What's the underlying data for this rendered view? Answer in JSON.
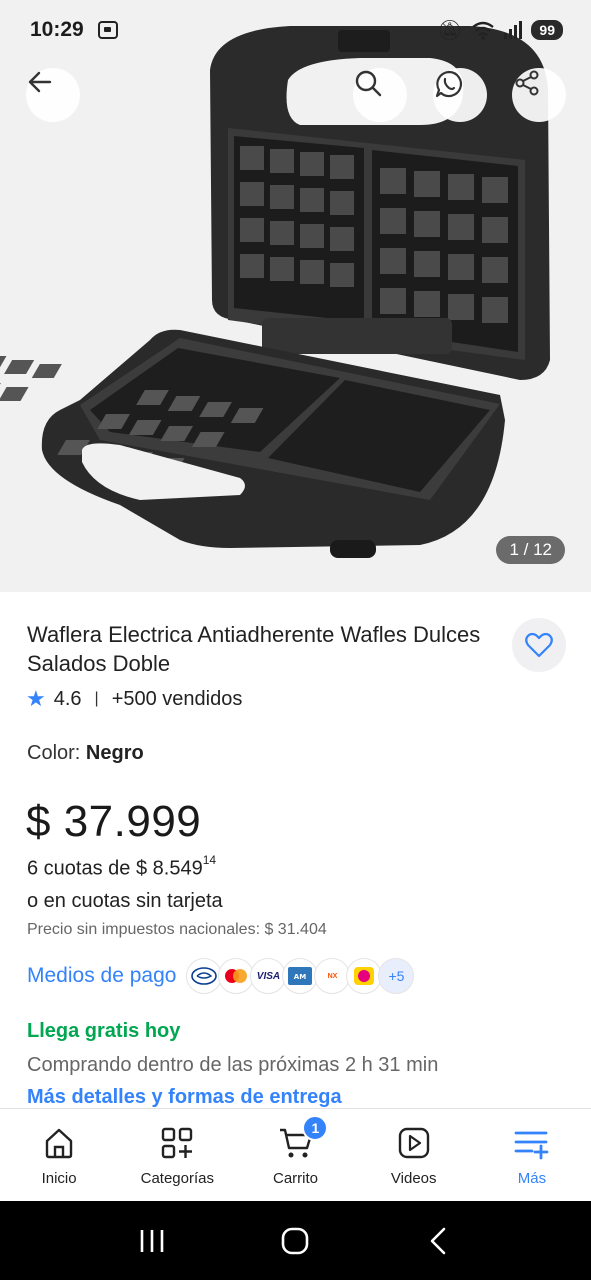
{
  "status_bar": {
    "time": "10:29",
    "battery": "99",
    "signal_label": "5"
  },
  "gallery": {
    "counter": "1 / 12"
  },
  "product": {
    "title": "Waflera Electrica Antiadherente Wafles Dulces Salados Doble",
    "rating": "4.6",
    "sold": "+500 vendidos",
    "color_label": "Color: ",
    "color_value": "Negro",
    "price": "$ 37.999",
    "installments_prefix": "6 cuotas de $ 8.549",
    "installments_cents": "14",
    "no_card": "o en cuotas sin tarjeta",
    "tax_note": "Precio sin impuestos nacionales: $ 31.404"
  },
  "payment": {
    "label": "Medios de pago",
    "methods": [
      "mercado-pago",
      "mastercard",
      "visa",
      "amex",
      "naranja-x",
      "cabal"
    ],
    "more": "+5"
  },
  "shipping": {
    "headline": "Llega gratis hoy",
    "timer": "Comprando dentro de las próximas 2 h 31 min",
    "details_link": "Más detalles y formas de entrega"
  },
  "bottom_nav": {
    "items": [
      {
        "label": "Inicio",
        "icon": "home-icon"
      },
      {
        "label": "Categorías",
        "icon": "categories-icon"
      },
      {
        "label": "Carrito",
        "icon": "cart-icon",
        "badge": "1"
      },
      {
        "label": "Videos",
        "icon": "play-icon"
      },
      {
        "label": "Más",
        "icon": "menu-plus-icon"
      }
    ]
  },
  "colors": {
    "accent": "#3483fa",
    "success": "#00a650"
  }
}
